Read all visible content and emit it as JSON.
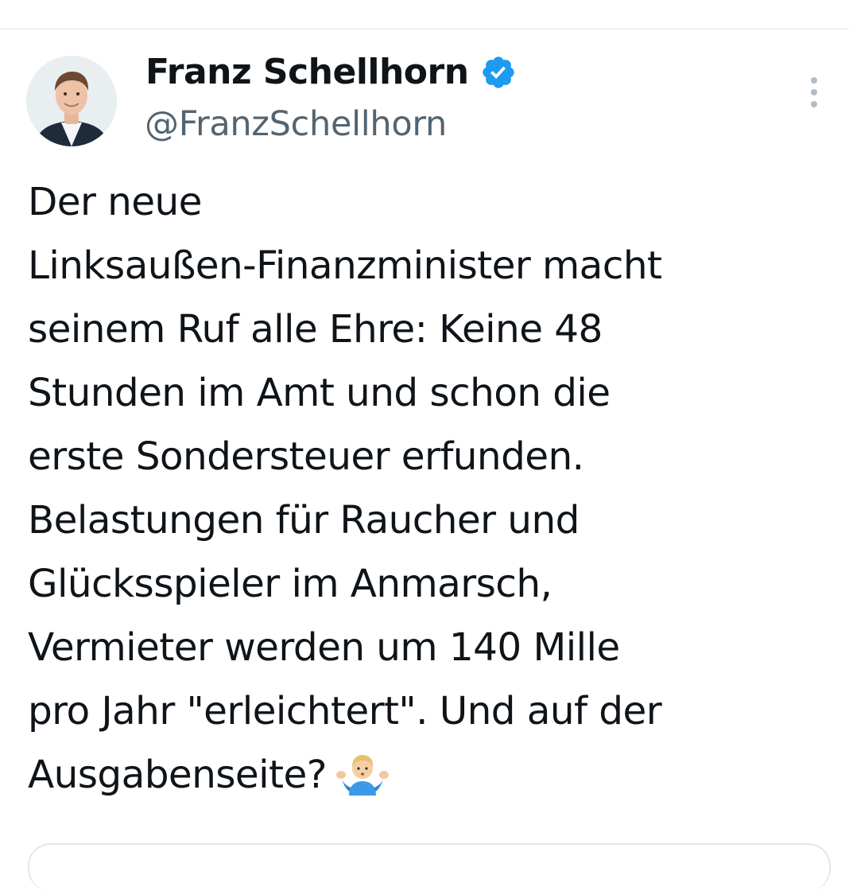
{
  "author": {
    "display_name": "Franz Schellhorn",
    "handle": "@FranzSchellhorn",
    "avatar_icon": "profile-photo",
    "verified_icon": "verified-badge-icon",
    "verified_color": "#1d9bf0"
  },
  "more_icon": "more-vertical-icon",
  "tweet": {
    "lines": [
      "Der neue",
      "Linksaußen-Finanzminister macht",
      "seinem Ruf alle Ehre: Keine 48",
      "Stunden im Amt und schon die",
      "erste Sondersteuer erfunden.",
      "Belastungen für Raucher und",
      "Glücksspieler im Anmarsch,",
      "Vermieter werden um 140 Mille",
      "pro Jahr \"erleichtert\". Und auf der",
      "Ausgabenseite?"
    ],
    "emoji_icon": "person-shrugging-emoji"
  }
}
